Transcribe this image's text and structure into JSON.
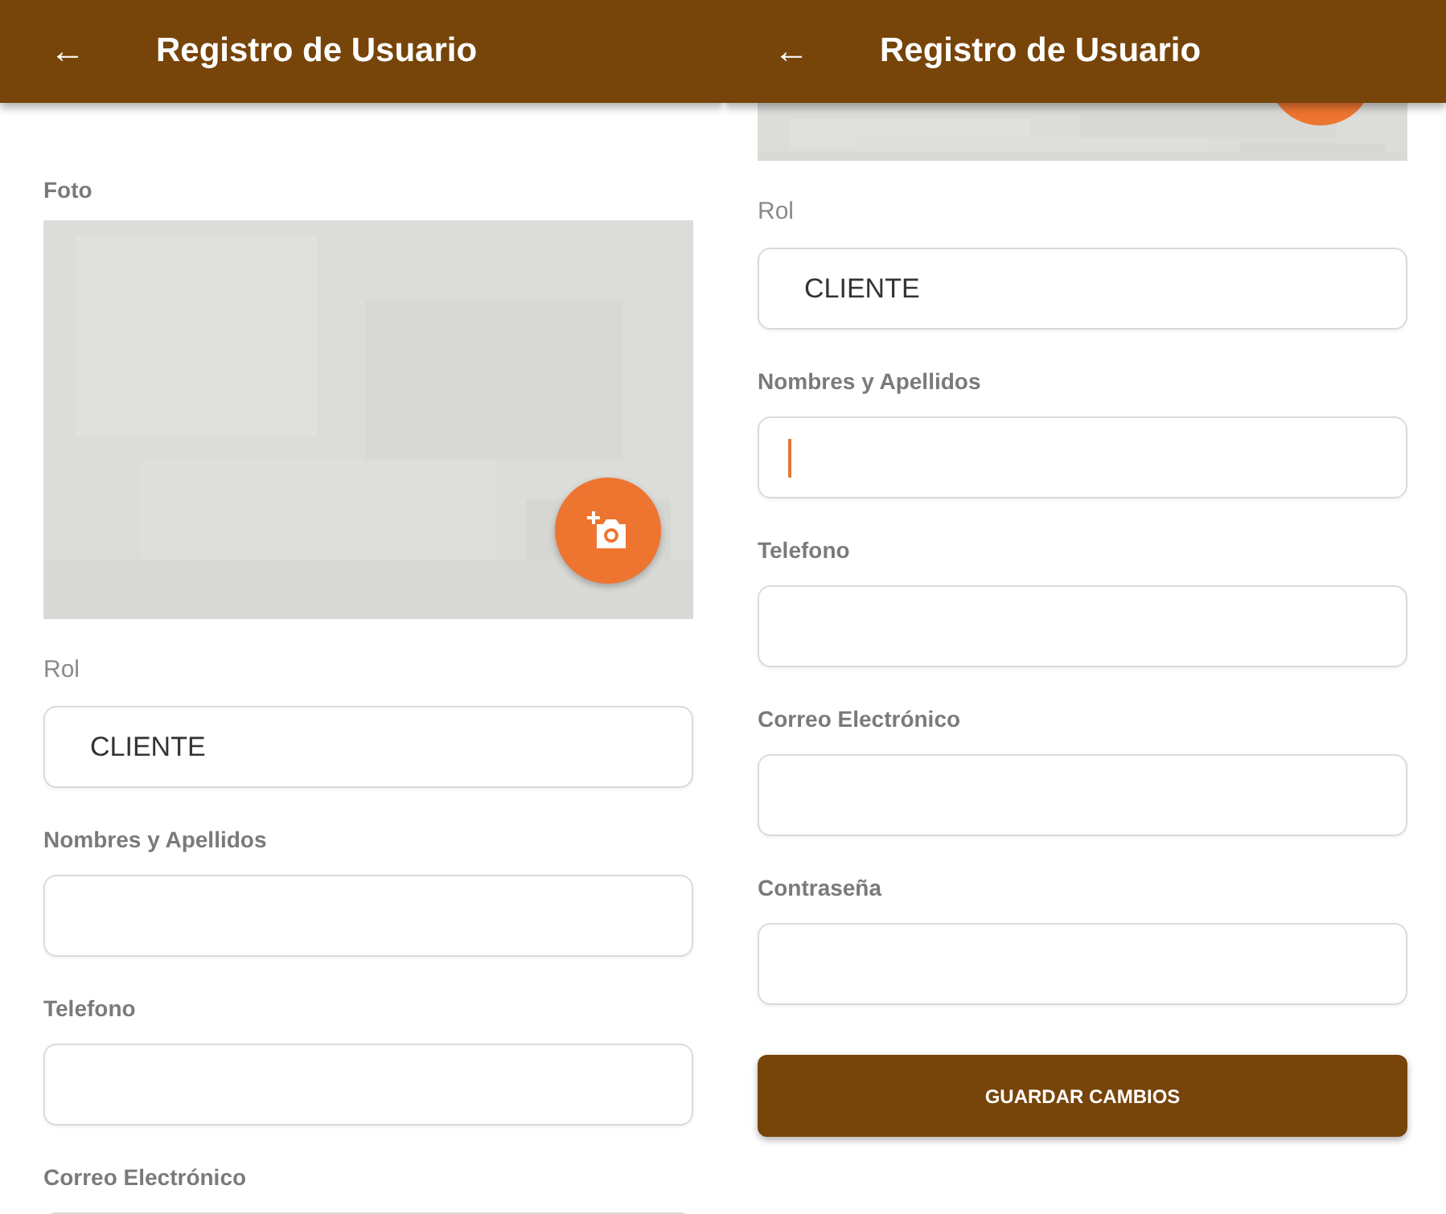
{
  "screens": [
    {
      "back_icon": "←",
      "title": "Registro de Usuario",
      "photo": {
        "label": "Foto",
        "kind": "full"
      },
      "fields": [
        {
          "kind": "select",
          "label": "Rol",
          "value": "CLIENTE"
        },
        {
          "kind": "text",
          "label": "Nombres y Apellidos"
        },
        {
          "kind": "text",
          "label": "Telefono"
        },
        {
          "kind": "text",
          "label": "Correo Electrónico"
        }
      ]
    },
    {
      "back_icon": "←",
      "title": "Registro de Usuario",
      "photo": {
        "kind": "edge"
      },
      "fields": [
        {
          "kind": "select",
          "label": "Rol",
          "value": "CLIENTE",
          "focused": false
        },
        {
          "kind": "text",
          "label": "Nombres y Apellidos",
          "focused": true
        },
        {
          "kind": "text",
          "label": "Telefono",
          "focused": false
        },
        {
          "kind": "text",
          "label": "Correo Electrónico",
          "focused": false
        },
        {
          "kind": "text",
          "label": "Contraseña",
          "focused": false
        }
      ],
      "button": "GUARDAR CAMBIOS"
    }
  ]
}
